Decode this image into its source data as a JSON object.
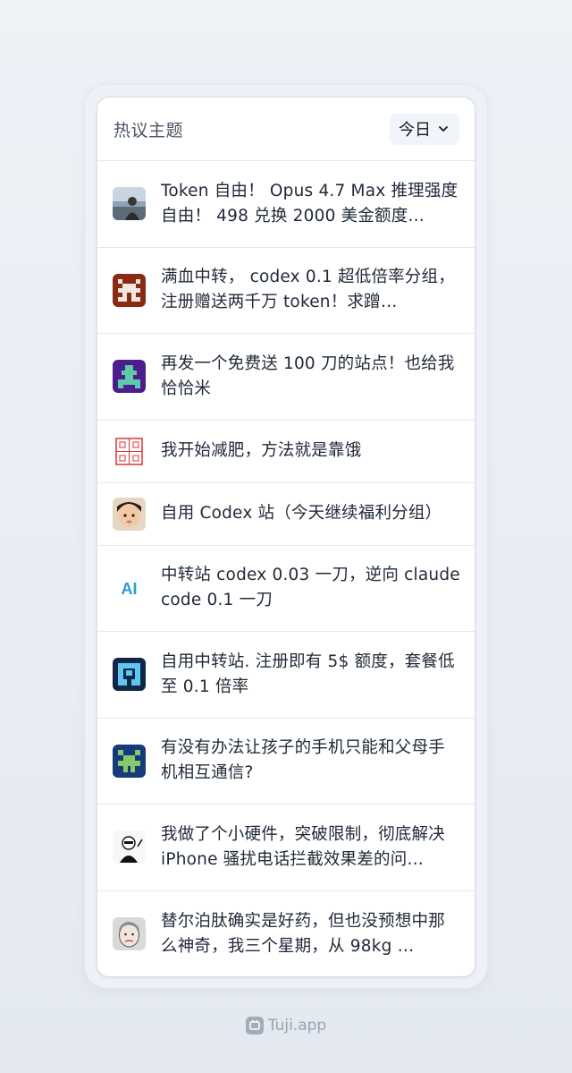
{
  "header": {
    "title": "热议主题",
    "period": "今日"
  },
  "topics": [
    {
      "title": "Token 自由！ Opus 4.7 Max 推理强度自由！ 498 兑换 2000 美金额度…",
      "avatar": "photo-avatar"
    },
    {
      "title": "满血中转， codex 0.1 超低倍率分组，注册赠送两千万 token！求蹭…",
      "avatar": "pixel-avatar-red"
    },
    {
      "title": "再发一个免费送 100 刀的站点！也给我恰恰米",
      "avatar": "pixel-avatar-purple"
    },
    {
      "title": "我开始减肥，方法就是靠饿",
      "avatar": "seal-stamp-avatar"
    },
    {
      "title": "自用 Codex 站（今天继续福利分组）",
      "avatar": "child-photo-avatar"
    },
    {
      "title": "中转站 codex 0.03 一刀，逆向 claude code 0.1 一刀",
      "avatar": "ai-logo-avatar",
      "avatar_text": "AI"
    },
    {
      "title": "自用中转站. 注册即有 5$ 额度，套餐低至 0.1 倍率",
      "avatar": "pixel-avatar-blue"
    },
    {
      "title": "有没有办法让孩子的手机只能和父母手机相互通信?",
      "avatar": "pixel-avatar-green"
    },
    {
      "title": "我做了个小硬件，突破限制，彻底解决 iPhone 骚扰电话拦截效果差的问…",
      "avatar": "cartoon-avatar"
    },
    {
      "title": "替尔泊肽确实是好药，但也没预想中那么神奇，我三个星期，从 98kg …",
      "avatar": "face-sketch-avatar"
    }
  ],
  "footer": {
    "brand": "Tuji.app"
  },
  "colors": {
    "background": "#e9edf3",
    "card": "#ffffff",
    "divider": "#e5e8ed",
    "text": "#1f2937",
    "muted": "#9ca3af"
  }
}
